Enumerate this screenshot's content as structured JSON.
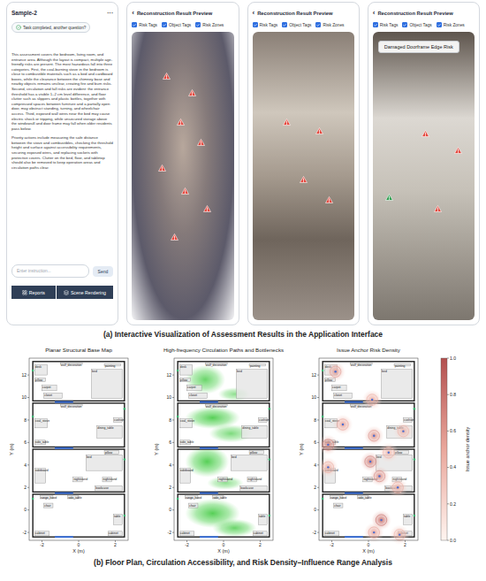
{
  "panel_a": {
    "caption": "(a) Interactive Visualization of Assessment Results in the Application Interface",
    "chat": {
      "title": "Sample-2",
      "menu": "···",
      "status": "Task completed, another question?",
      "paragraphs": [
        "This assessment covers the bedroom, living room, and entrance area. Although the layout is compact, multiple age-friendly risks are present. The most hazardous fall into three categories. First, the coal-burning stove in the bedroom is close to combustible materials such as a bed and cardboard boxes, while the clearance between the chimney base and nearby objects remains unclear, creating fire and burn risks. Second, circulation and fall risks are evident: the entrance threshold has a visible 1–2 cm level difference, and floor clutter such as slippers and plastic bottles, together with compressed spaces between furniture and a partially open door, may obstruct standing, turning, and wheelchair access. Third, exposed wall wires near the bed may cause electric shock or tripping, while unsecured storage above the windowsill and door frame may fall when older residents pass below.",
        "Priority actions include measuring the safe distance between the stove and combustibles, checking the threshold height and surface against accessibility requirements, securing exposed wires, and replacing sockets with protective covers. Clutter on the bed, floor, and tabletop should also be removed to keep operation areas and circulation paths clear."
      ],
      "input_placeholder": "Enter instruction...",
      "send": "Send",
      "nav": [
        {
          "label": "Reports"
        },
        {
          "label": "Scene Rendering"
        }
      ]
    },
    "previews": [
      {
        "back": "‹",
        "title": "Reconstruction Result Preview",
        "kind": "model",
        "toggles": [
          {
            "label": "Risk Tags",
            "checked": true
          },
          {
            "label": "Object Tags",
            "checked": true
          },
          {
            "label": "Risk Zones",
            "checked": true
          }
        ],
        "markers": [
          {
            "color": "#e5473d"
          },
          {
            "color": "#e5473d"
          },
          {
            "color": "#e5473d"
          },
          {
            "color": "#e5473d"
          },
          {
            "color": "#e5473d"
          },
          {
            "color": "#e5473d"
          },
          {
            "color": "#e5473d"
          },
          {
            "color": "#e5473d"
          }
        ]
      },
      {
        "back": "‹",
        "title": "Reconstruction Result Preview",
        "kind": "interior",
        "toggles": [
          {
            "label": "Risk Tags",
            "checked": true
          },
          {
            "label": "Object Tags",
            "checked": true
          },
          {
            "label": "Risk Zones",
            "checked": true
          }
        ],
        "markers": [
          {
            "color": "#e5473d"
          },
          {
            "color": "#e5473d"
          },
          {
            "color": "#e5473d"
          },
          {
            "color": "#e5473d"
          }
        ]
      },
      {
        "back": "‹",
        "title": "Reconstruction Result Preview",
        "kind": "doorway",
        "toggles": [
          {
            "label": "Risk Tags",
            "checked": true
          },
          {
            "label": "Object Tags",
            "checked": true
          },
          {
            "label": "Risk Zones",
            "checked": true
          }
        ],
        "tag": "Damaged Doorframe Edge Risk",
        "markers": [
          {
            "color": "#2e9e4f"
          },
          {
            "color": "#e5473d"
          },
          {
            "color": "#e5473d"
          },
          {
            "color": "#e5473d"
          }
        ]
      }
    ]
  },
  "panel_b": {
    "caption": "(b) Floor Plan, Circulation Accessibility, and Risk Density–Influence Range Analysis",
    "plots": [
      {
        "title": "Planar Structural Base Map",
        "kind": "base"
      },
      {
        "title": "High-frequency Circulation Paths and Bottlenecks",
        "kind": "circulation"
      },
      {
        "title": "Issue Anchor Risk Density",
        "kind": "risk"
      }
    ],
    "x_label": "X (m)",
    "y_label": "Y (m)",
    "x_ticks": [
      "-2",
      "0",
      "2"
    ],
    "y_ticks": [
      "12",
      "10",
      "8",
      "6",
      "4",
      "2",
      "0",
      "-2"
    ],
    "rooms": [
      {
        "x0": -2.5,
        "x1": 2.5,
        "y0": 9.7,
        "y1": 13.2
      },
      {
        "x0": -2.5,
        "x1": 2.5,
        "y0": 5.6,
        "y1": 9.5
      },
      {
        "x0": -2.5,
        "x1": 2.5,
        "y0": 1.6,
        "y1": 5.4
      },
      {
        "x0": -2.5,
        "x1": 2.5,
        "y0": -2.4,
        "y1": 1.4
      }
    ],
    "furniture": [
      {
        "label": "wall_decoration",
        "x": -1.0,
        "y": 12.95,
        "w": 1.2,
        "h": 0.15
      },
      {
        "label": "desk",
        "x": -2.4,
        "y": 12.0,
        "w": 0.7,
        "h": 0.9
      },
      {
        "label": "painting",
        "x": 1.4,
        "y": 12.8,
        "w": 0.9,
        "h": 0.2
      },
      {
        "label": "pillow",
        "x": -2.4,
        "y": 11.4,
        "w": 0.6,
        "h": 0.35
      },
      {
        "label": "carpet",
        "x": -2.0,
        "y": 10.6,
        "w": 0.8,
        "h": 0.5
      },
      {
        "label": "closet",
        "x": -1.9,
        "y": 9.9,
        "w": 1.0,
        "h": 0.5
      },
      {
        "label": "bed",
        "x": 0.7,
        "y": 9.9,
        "w": 1.7,
        "h": 2.6
      },
      {
        "label": "wall_decoration",
        "x": -1.0,
        "y": 9.25,
        "w": 1.2,
        "h": 0.15
      },
      {
        "label": "coal_stove",
        "x": -2.4,
        "y": 7.3,
        "w": 0.7,
        "h": 0.8
      },
      {
        "label": "cushion",
        "x": 1.9,
        "y": 7.8,
        "w": 0.5,
        "h": 0.4
      },
      {
        "label": "dining_table",
        "x": 1.0,
        "y": 6.4,
        "w": 1.4,
        "h": 1.1
      },
      {
        "label": "side_table",
        "x": -2.4,
        "y": 5.8,
        "w": 0.6,
        "h": 0.4
      },
      {
        "label": "bed",
        "x": 0.4,
        "y": 3.5,
        "w": 2.0,
        "h": 1.4
      },
      {
        "label": "pillow",
        "x": 1.4,
        "y": 4.95,
        "w": 0.8,
        "h": 0.35
      },
      {
        "label": "sideboard",
        "x": -2.4,
        "y": 2.4,
        "w": 0.6,
        "h": 1.3
      },
      {
        "label": "nightstand",
        "x": -0.3,
        "y": 2.5,
        "w": 0.5,
        "h": 0.4
      },
      {
        "label": "nightstand",
        "x": 1.3,
        "y": 2.5,
        "w": 0.5,
        "h": 0.4
      },
      {
        "label": "bookcase",
        "x": 0.9,
        "y": 1.7,
        "w": 1.5,
        "h": 0.45
      },
      {
        "label": "range_hood",
        "x": -2.1,
        "y": 1.0,
        "w": 0.7,
        "h": 0.25
      },
      {
        "label": "side_table",
        "x": -0.6,
        "y": 1.0,
        "w": 0.6,
        "h": 0.3
      },
      {
        "label": "chair",
        "x": -1.9,
        "y": 0.2,
        "w": 0.5,
        "h": 0.4
      },
      {
        "label": "table",
        "x": 1.9,
        "y": -1.3,
        "w": 0.5,
        "h": 0.9
      },
      {
        "label": "cabinet",
        "x": -2.4,
        "y": -2.3,
        "w": 0.8,
        "h": 0.4
      },
      {
        "label": "cabinet",
        "x": 1.6,
        "y": -2.3,
        "w": 0.8,
        "h": 0.4
      }
    ],
    "doors": [
      {
        "x0": -1.3,
        "x1": -0.3,
        "y": 9.6
      },
      {
        "x0": -1.3,
        "x1": -0.3,
        "y": 5.5
      },
      {
        "x0": -1.3,
        "x1": -0.3,
        "y": 1.5
      },
      {
        "x0": -1.3,
        "x1": -0.3,
        "y": -2.4
      }
    ],
    "wall_markers": [
      {
        "x": -2.5,
        "y": 12.4
      },
      {
        "x": 2.5,
        "y": 9.0
      },
      {
        "x": -2.5,
        "y": 8.3
      },
      {
        "x": 2.5,
        "y": 4.5
      },
      {
        "x": -2.5,
        "y": 1.0
      },
      {
        "x": 2.5,
        "y": -0.5
      }
    ],
    "circulation": [
      {
        "x": -1.0,
        "y": 11.6,
        "rx": 1.1,
        "ry": 1.3,
        "intensity": 0.8
      },
      {
        "x": 0.6,
        "y": 10.3,
        "rx": 0.9,
        "ry": 0.6,
        "intensity": 0.6
      },
      {
        "x": -0.6,
        "y": 8.2,
        "rx": 1.5,
        "ry": 1.0,
        "intensity": 0.9
      },
      {
        "x": 0.4,
        "y": 6.8,
        "rx": 1.2,
        "ry": 0.8,
        "intensity": 0.7
      },
      {
        "x": -0.9,
        "y": 4.3,
        "rx": 1.2,
        "ry": 1.4,
        "intensity": 0.9
      },
      {
        "x": 0.1,
        "y": 2.4,
        "rx": 1.0,
        "ry": 0.6,
        "intensity": 0.6
      },
      {
        "x": -0.6,
        "y": -0.3,
        "rx": 1.5,
        "ry": 1.3,
        "intensity": 0.9
      },
      {
        "x": 0.6,
        "y": -1.6,
        "rx": 1.2,
        "ry": 0.8,
        "intensity": 0.8
      }
    ],
    "risk_anchors": [
      {
        "x": -1.8,
        "y": 12.3,
        "density": 0.6
      },
      {
        "x": 0.2,
        "y": 9.8,
        "density": 0.5
      },
      {
        "x": -1.4,
        "y": 7.6,
        "density": 0.55
      },
      {
        "x": 0.3,
        "y": 6.6,
        "density": 0.65
      },
      {
        "x": -2.2,
        "y": 5.8,
        "density": 0.7
      },
      {
        "x": -2.2,
        "y": 3.8,
        "density": 0.5
      },
      {
        "x": 0.1,
        "y": 4.3,
        "density": 0.8
      },
      {
        "x": 1.1,
        "y": 5.1,
        "density": 0.45
      },
      {
        "x": 0.6,
        "y": 3.0,
        "density": 0.7
      },
      {
        "x": 1.6,
        "y": 2.0,
        "density": 0.5
      },
      {
        "x": 1.9,
        "y": 7.0,
        "density": 0.45
      },
      {
        "x": 0.7,
        "y": -0.9,
        "density": 0.85
      },
      {
        "x": 0.3,
        "y": -2.0,
        "density": 0.55
      },
      {
        "x": 1.7,
        "y": -2.2,
        "density": 0.45
      }
    ],
    "colorbar": {
      "label": "Issue anchor density",
      "ticks": [
        "1.0",
        "0.8",
        "0.6",
        "0.4",
        "0.2",
        "0.0"
      ]
    }
  }
}
